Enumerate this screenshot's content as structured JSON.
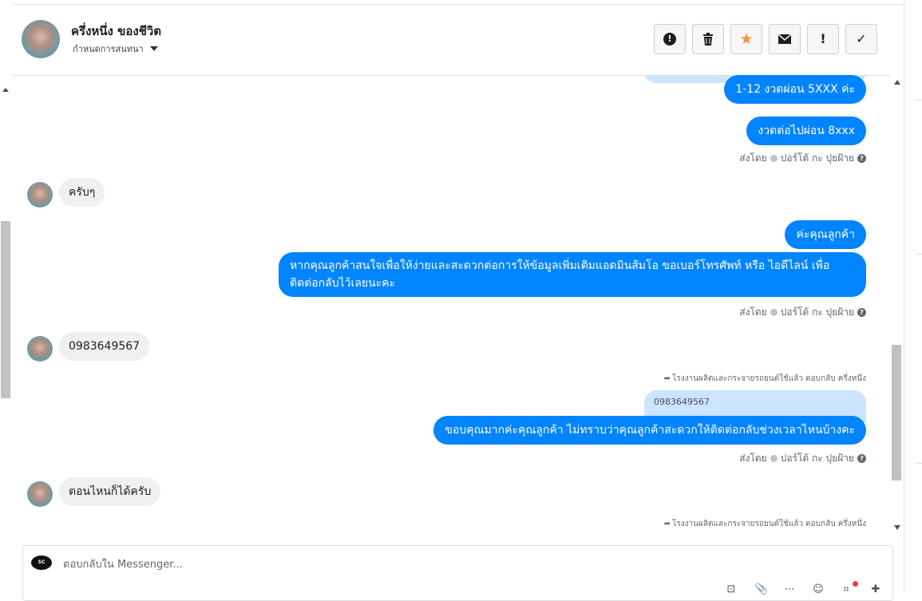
{
  "header": {
    "contact_name": "ครึ่งหนึ่ง ของชีวิต",
    "assign_label": "กำหนดการสนทนา",
    "actions": [
      {
        "name": "mark-spam",
        "icon": "alert-circle-icon",
        "glyph": "❗"
      },
      {
        "name": "delete",
        "icon": "trash-icon",
        "glyph": "🗑"
      },
      {
        "name": "star",
        "icon": "star-icon",
        "glyph": "★"
      },
      {
        "name": "mark-unread",
        "icon": "envelope-icon",
        "glyph": "✉"
      },
      {
        "name": "follow-up",
        "icon": "exclamation-icon",
        "glyph": "!"
      },
      {
        "name": "mark-done",
        "icon": "check-icon",
        "glyph": "✓"
      }
    ]
  },
  "thread": {
    "msg1": "1-12 งวดผ่อน 5XXX ค่ะ",
    "msg2": "งวดต่อไปผ่อน 8xxx",
    "sent_by_1": "ส่งโดย",
    "sender_name_1": "ปอร์โต้ กะ ปุยฝ้าย",
    "in1": "ครับๆ",
    "msg3": "ค่ะคุณลูกค้า",
    "msg4": "หากคุณลูกค้าสนใจเพื่อให้ง่ายและสะดวกต่อการให้ข้อมูลเพิ่มเติมแอดมินส้มโอ ขอเบอร์โทรศัพท์ หรือ ไอดีไลน์ เพื่อติดต่อกลับไว้เลยนะคะ",
    "sent_by_2": "ส่งโดย",
    "sender_name_2": "ปอร์โต้ กะ ปุยฝ้าย",
    "in2": "0983649567",
    "reply_note_1": "โรงงานผลิตและกระจายรถยนต์ใช้แล้ว ตอบกลับ ครึ่งหนึ่ง",
    "quote_text": "0983649567",
    "msg5": "ขอบคุณมากค่ะคุณลูกค้า ไม่ทราบว่าคุณลูกค้าสะดวกให้ติดต่อกลับช่วงเวลาไหนบ้างคะ",
    "sent_by_3": "ส่งโดย",
    "sender_name_3": "ปอร์โต้ กะ ปุยฝ้าย",
    "in3": "ตอนไหนก็ได้ครับ",
    "reply_note_2": "โรงงานผลิตและกระจายรถยนต์ใช้แล้ว ตอบกลับ ครึ่งหนึ่ง"
  },
  "composer": {
    "placeholder": "ตอบกลับใน Messenger...",
    "page_logo_text": "SC",
    "tools": [
      "saved-reply-icon",
      "attach-icon",
      "more-icon",
      "emoji-icon",
      "app-icon",
      "pin-icon"
    ]
  },
  "colors": {
    "outgoing_bubble": "#0084ff",
    "incoming_bubble": "#f1f0f0",
    "quote_bubble": "#cce4ff",
    "star": "#f7923a"
  }
}
